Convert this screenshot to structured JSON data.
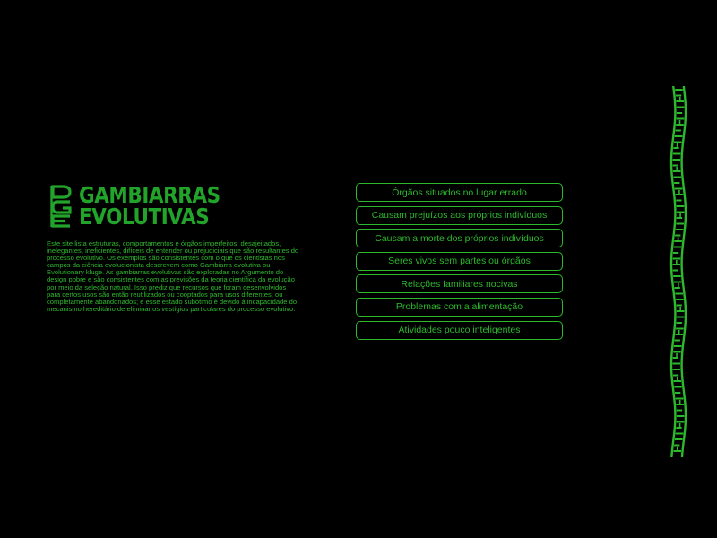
{
  "colors": {
    "background": "#000000",
    "accent": "#2eb82e",
    "logo": "#22a32a"
  },
  "logo": {
    "mark_icon": "dna-dge-logo-icon",
    "line1": "GAMBIARRAS",
    "line2": "EVOLUTIVAS"
  },
  "description": "Este site lista estruturas, comportamentos e órgãos imperfeitos, desajeitados, inelegantes, ineficientes, difíceis de entender ou prejudiciais que são resultantes do processo evolutivo. Os exemplos são consistentes com o que os cientistas nos campos da ciência evolucionista descrevem como Gambiarra evolutiva ou Evolutionary kluge. As gambiarras evolutivas são exploradas no Argumento do design pobre e são consistentes com as previsões da teoria científica da evolução por meio da seleção natural. Isso prediz que recursos que foram desenvolvidos para certos usos são então reutilizados ou cooptados para usos diferentes, ou completamente abandonados; e esse estado subótimo é devido à incapacidade do mecanismo hereditário de eliminar os vestígios particulares do processo evolutivo.",
  "menu": {
    "items": [
      {
        "label": "Órgãos situados no lugar errado"
      },
      {
        "label": "Causam prejuízos aos próprios indivíduos"
      },
      {
        "label": "Causam a morte dos próprios indivíduos"
      },
      {
        "label": "Seres vivos sem partes ou órgãos"
      },
      {
        "label": "Relações familiares nocivas"
      },
      {
        "label": "Problemas com a alimentação"
      },
      {
        "label": "Atividades pouco inteligentes"
      }
    ]
  },
  "decoration": {
    "side_strip_icon": "dna-strand-icon"
  }
}
